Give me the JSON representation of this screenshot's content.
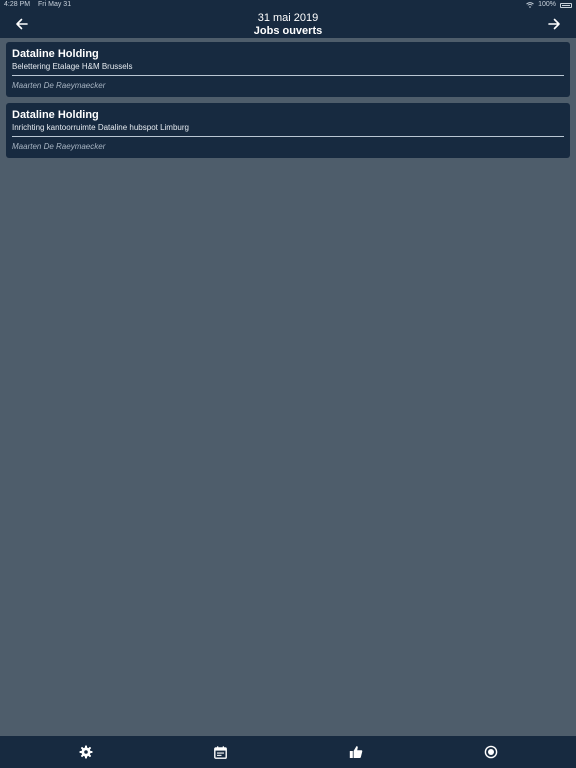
{
  "status_bar": {
    "time": "4:28 PM",
    "day": "Fri May 31",
    "battery": "100%"
  },
  "nav": {
    "date": "31 mai 2019",
    "title": "Jobs ouverts",
    "prev_icon": "arrow-left-icon",
    "next_icon": "arrow-right-icon"
  },
  "jobs": [
    {
      "company": "Dataline Holding",
      "description": "Belettering Etalage H&M Brussels",
      "person": "Maarten De Raeymaecker"
    },
    {
      "company": "Dataline Holding",
      "description": "Inrichting kantoorruimte Dataline hubspot Limburg",
      "person": "Maarten De Raeymaecker"
    }
  ],
  "tabs": [
    {
      "icon": "gear-icon"
    },
    {
      "icon": "calendar-icon"
    },
    {
      "icon": "thumbs-up-icon"
    },
    {
      "icon": "record-icon"
    }
  ],
  "colors": {
    "background": "#4e5d6b",
    "bar": "#172a40",
    "card": "#172a40",
    "text": "#ffffff",
    "muted": "#a7b4c2"
  }
}
